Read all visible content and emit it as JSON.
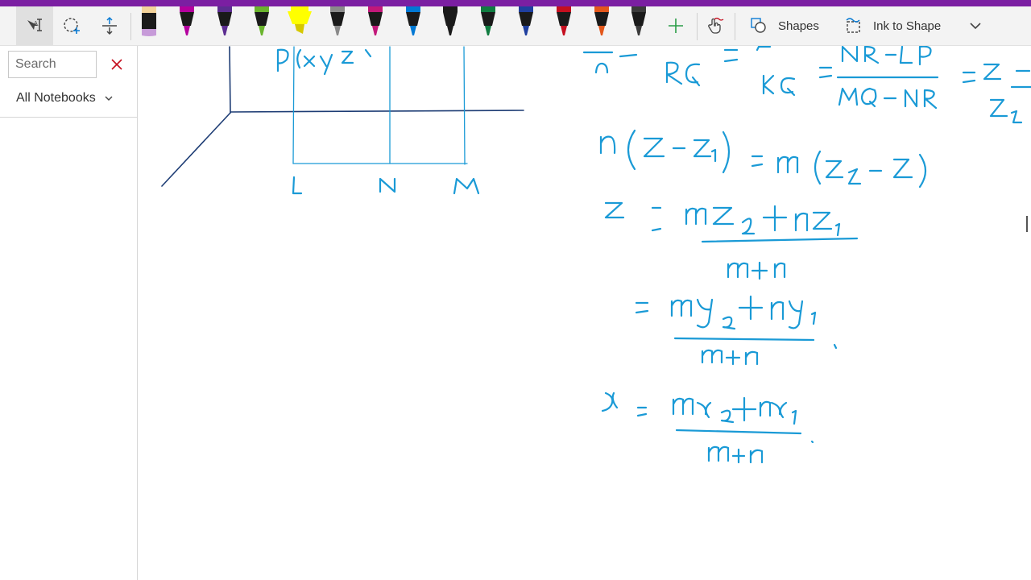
{
  "ribbon": {
    "tools": [
      "lasso-select-icon",
      "shape-select-icon",
      "insert-space-icon"
    ],
    "pens": [
      {
        "name": "pen-white",
        "color": "#ffffff"
      },
      {
        "name": "pen-magenta",
        "color": "#b4009e"
      },
      {
        "name": "pen-purple",
        "color": "#5c2d91"
      },
      {
        "name": "pen-lime",
        "color": "#6ab42d"
      },
      {
        "name": "highlighter-yellow",
        "color": "#ffff00"
      },
      {
        "name": "pen-gray",
        "color": "#8a8a8a"
      },
      {
        "name": "pen-pink",
        "color": "#c2187a"
      },
      {
        "name": "pen-blue",
        "color": "#0078d4"
      },
      {
        "name": "pen-black",
        "color": "#1a1a1a"
      },
      {
        "name": "pen-green",
        "color": "#107c41"
      },
      {
        "name": "pen-navy",
        "color": "#1f3f9f"
      },
      {
        "name": "pen-red",
        "color": "#c50f1f"
      },
      {
        "name": "pen-orange",
        "color": "#e3571b"
      },
      {
        "name": "pen-darkgray",
        "color": "#3b3b3b"
      }
    ],
    "shapes_label": "Shapes",
    "ink_to_shape_label": "Ink to Shape"
  },
  "sidebar": {
    "search_placeholder": "Search",
    "notebooks_label": "All Notebooks"
  },
  "ink_color": "#1a9ad6",
  "axis_color": "#1d3c74"
}
